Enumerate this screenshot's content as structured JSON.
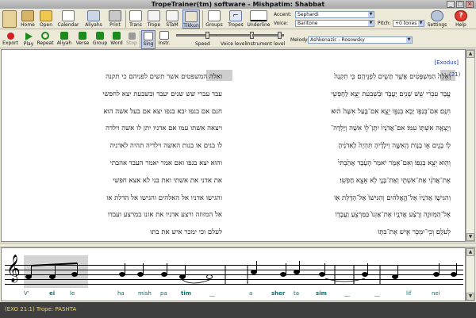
{
  "window": {
    "title": "TropeTrainer(tm) software - Mishpatim: Shabbat",
    "controls": [
      "_",
      "□",
      "×"
    ]
  },
  "toolbar1": {
    "buttons": [
      "Home",
      "Open",
      "Calendar",
      "Aliyahs",
      "Print",
      "Trans",
      "Trope",
      "STaM",
      "Tikkun",
      "Groups",
      "Tropes",
      "Underline",
      "Settings",
      "Help"
    ],
    "tropes_value": "⌐",
    "accent_label": "Accent:",
    "accent_value": "Sephardi",
    "voice_label": "Voice:",
    "voice_value": "Baritone",
    "pitch_label": "Pitch:",
    "pitch_value": "+0 tones"
  },
  "toolbar2": {
    "buttons": [
      "Export",
      "Play",
      "Repeat",
      "Aliyah",
      "Verse",
      "Group",
      "Word",
      "Stop",
      "Sing",
      "Instr."
    ],
    "speed_label": "Speed",
    "voice_level_label": "Voice level",
    "instrument_level_label": "Instrument level",
    "melody_label": "Melody:",
    "melody_value": "Ashkenazic - Rosowsky",
    "speed_level": 0.55,
    "voice_level": 0.9,
    "instrument_level": 0.9
  },
  "textpane": {
    "book_link": "[Exodus]",
    "verse_number": "(21)",
    "left_column": [
      "ואלה המשפטים אשר תשים לפניהם כי תקנה",
      "עבד עברי שש שנים יעבד ובשבעת יצא לחפשי",
      "חנם אם בגפו יבא בגפו יצא אם בעל אשה הוא",
      "ויצאה אשתו עמו אם אדניו יתן לו אשה וילדה",
      "לו בנים או בנות האשה וילדיה תהיה לאדניה",
      "והוא יצא בגפו ואם אמר יאמר העבד אהבתי",
      "את אדני את אשתי ואת בני לא אצא חפשי",
      "והגישו אדניו אל האלהים והגישו אל הדלת או",
      "אל המזוזה ורצע אדניו את אזנו במרצע ועבדו",
      "לעלם וכי ימכר איש את בתו"
    ],
    "right_column": [
      "וְאֵ֙לֶּה֙ הַמִּשְׁפָּטִ֔ים אֲשֶׁ֥ר תָּשִׂ֖ים לִפְנֵיהֶֽם׃ כִּ֤י תִקְנֶה֙",
      "עֶ֣בֶד עִבְרִ֔י שֵׁ֥שׁ שָׁנִ֖ים יַעֲבֹ֑ד וּבַ֨שְּׁבִעִ֔ת יֵצֵ֥א לַֽחָפְשִׁ֖י",
      "חִנָּֽם׃ אִם־בְּגַפּ֥וֹ יָבֹ֖א בְּגַפּ֣וֹ יֵצֵ֑א אִם־בַּ֤עַל אִשָּׁה֙ ה֔וּא",
      "וְיָצְאָ֥ה אִשְׁתּ֖וֹ עִמּֽוֹ׃ אִם־אֲדֹנָיו֙ יִתֶּן־ל֣וֹ אִשָּׁ֔ה וְיָלְדָה־",
      "ל֥וֹ בָנִ֖ים א֣וֹ בָנ֑וֹת הָֽאִשָּׁ֣ה וִילָדֶ֗יהָ תִּהְיֶה֙ לַֽאדֹנֶ֔יהָ",
      "וְה֖וּא יֵצֵ֥א בְגַפּֽוֹ׃ וְאִם־אָמֹ֤ר יֹאמַר֙ הָעֶ֔בֶד אָהַ֙בְתִּי֙",
      "אֶת־אֲדֹנִ֔י אֶת־אִשְׁתִּ֖י וְאֶת־בָּנָ֑י לֹ֥א אֵצֵ֖א חָפְשִֽׁי׃",
      "וְהִגִּישׁ֤וֹ אֲדֹנָיו֙ אֶל־הָ֣אֱלֹהִ֔ים וְהִגִּישׁוֹ֙ אֶל־הַדֶּ֔לֶת א֖וֹ",
      "אֶל־הַמְּזוּזָ֑ה וְרָצַ֨ע אֲדֹנָ֤יו אֶת־אָזְנוֹ֙ בַּמַּרְצֵ֔עַ וַעֲבָד֖וֹ",
      "לְעֹלָֽם׃ וְכִֽי־יִמְכֹּ֥ר אִ֛ישׁ אֶת־בִּתּ֖וֹ"
    ]
  },
  "music": {
    "syllables": [
      "V'",
      "ei",
      "le",
      "ha",
      "mish",
      "pa",
      "tim",
      "__",
      "a",
      "sher",
      "ta",
      "sim",
      "__",
      "__",
      "lif",
      "nei"
    ]
  },
  "status": {
    "text": "(EXO 21:1)   Trope: PASHTA"
  },
  "colors": {
    "accent_blue": "#1a3fcc",
    "syllable_teal": "#0a6f6f",
    "status_yellow": "#e8d66a",
    "highlight_gray": "#cfcfcf"
  }
}
